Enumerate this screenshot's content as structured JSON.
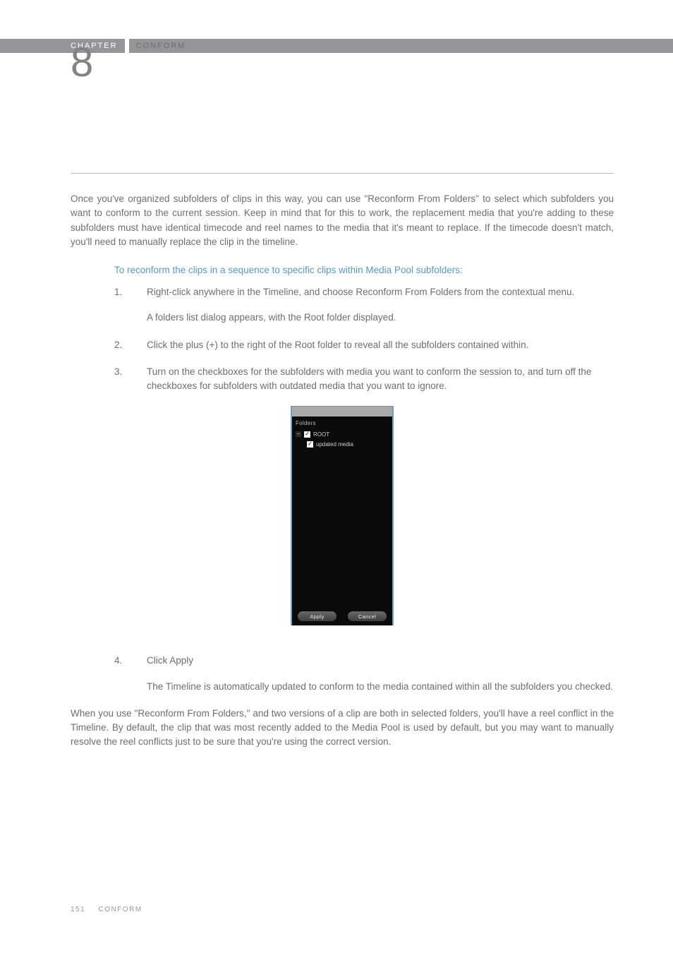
{
  "header": {
    "chapter_label": "CHAPTER",
    "chapter_title": "CONFORM",
    "chapter_number": "8"
  },
  "intro_paragraph": "Once you've organized subfolders of clips in this way, you can use \"Reconform From Folders\" to select which subfolders you want to conform to the current session. Keep in mind that for this to work, the replacement media that you're adding to these subfolders must have identical timecode and reel names to the media that it's meant to replace. If the timecode doesn't match, you'll need to manually replace the clip in the timeline.",
  "subheading": "To reconform the clips in a sequence to specific clips within Media Pool subfolders:",
  "steps": [
    {
      "num": "1.",
      "paras": [
        "Right-click anywhere in the Timeline, and choose Reconform From Folders from the contextual menu.",
        "A folders list dialog appears, with the Root folder displayed."
      ]
    },
    {
      "num": "2.",
      "paras": [
        "Click the plus (+) to the right of the Root folder to reveal all the subfolders contained within."
      ]
    },
    {
      "num": "3.",
      "paras": [
        "Turn on the checkboxes for the subfolders with media you want to conform the session to, and turn off the checkboxes for subfolders with outdated media that you want to ignore."
      ]
    }
  ],
  "dialog": {
    "title": "Folders",
    "root_toggle": "−",
    "root_label": "ROOT",
    "child_label": "updated media",
    "check_glyph": "✓",
    "apply": "Apply",
    "cancel": "Cancel"
  },
  "steps2": [
    {
      "num": "4.",
      "paras": [
        "Click Apply",
        "The Timeline is automatically updated to conform to the media contained within all the subfolders you checked."
      ]
    }
  ],
  "closing_paragraph": "When you use \"Reconform From Folders,\" and two versions of a clip are both in selected folders, you'll have a reel conflict in the Timeline. By default, the clip that was most recently added to the Media Pool is used by default, but you may want to manually resolve the reel conflicts just to be sure that you're using the correct version.",
  "footer": {
    "page_number": "151",
    "section": "CONFORM"
  }
}
